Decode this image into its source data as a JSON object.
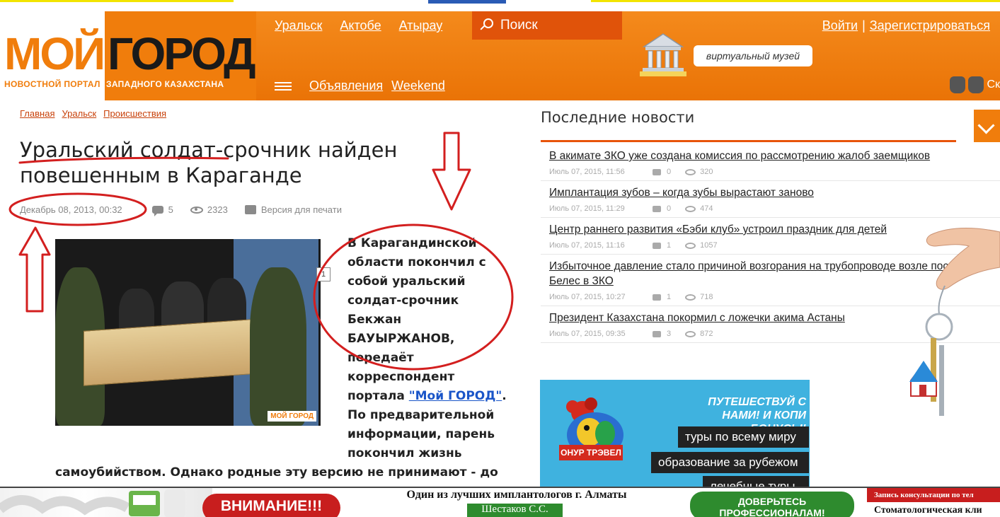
{
  "header": {
    "logo_part1": "МОЙ",
    "logo_part2": "ГОРОД",
    "tagline_part1": "НОВОСТНОЙ ПОРТАЛ",
    "tagline_part2": "ЗАПАДНОГО КАЗАХСТАНА",
    "cities": [
      "Уральск",
      "Актобе",
      "Атырау"
    ],
    "search_placeholder": "Поиск",
    "login": "Войти",
    "separator": "|",
    "register": "Зарегистрироваться",
    "museum_label": "виртуальный музей",
    "sub_links": [
      "Объявления",
      "Weekend"
    ],
    "apps_label": "Ск"
  },
  "breadcrumb": [
    "Главная",
    "Уральск",
    "Происшествия"
  ],
  "article": {
    "title": "Уральский солдат-срочник найден повешенным в Караганде",
    "date": "Декабрь 08, 2013, 00:32",
    "comments": "5",
    "views": "2323",
    "print": "Версия для печати",
    "footnote_badge": "1",
    "photo_watermark": "МОЙ ГОРОД",
    "text_lead": "В Карагандинской области покончил с собой уральский солдат-срочник Бекжан БАУЫРЖАНОВ, передаёт корреспондент портала ",
    "text_link": "\"Мой ГОРОД\"",
    "text_after_link": ". По предварительной информации, парень покончил жизнь",
    "text_continuation": "самоубийством. Однако родные эту версию не принимают - до"
  },
  "sidebar": {
    "title": "Последние новости",
    "news": [
      {
        "title": "В акимате ЗКО уже создана комиссия по рассмотрению жалоб заемщиков",
        "date": "Июль 07, 2015, 11:56",
        "comments": "0",
        "views": "320"
      },
      {
        "title": "Имплантация зубов – когда зубы вырастают заново",
        "date": "Июль 07, 2015, 11:29",
        "comments": "0",
        "views": "474"
      },
      {
        "title": "Центр раннего развития «Бэби клуб» устроил праздник для детей",
        "date": "Июль 07, 2015, 11:16",
        "comments": "1",
        "views": "1057"
      },
      {
        "title": "Избыточное давление стало причиной возгорания на трубопроводе возле поселка Белес в ЗКО",
        "date": "Июль 07, 2015, 10:27",
        "comments": "1",
        "views": "718"
      },
      {
        "title": "Президент Казахстана покормил с ложечки акима Астаны",
        "date": "Июль 07, 2015, 09:35",
        "comments": "3",
        "views": "872"
      }
    ]
  },
  "travel_ad": {
    "headline": "ПУТЕШЕСТВУЙ С НАМИ! И КОПИ БОНУСЫ!",
    "pills": [
      "туры по всему миру",
      "образование за рубежом",
      "лечебные туры"
    ],
    "brand": "ОНУР ТРЭВЕЛ"
  },
  "bottom_banner": {
    "red_label": "ВНИМАНИЕ!!!",
    "headline": "Один из лучших имплантологов г. Алматы",
    "doctor": "Шестаков С.С.",
    "green_label": "ДОВЕРЬТЕСЬ ПРОФЕССИОНАЛАМ!",
    "right_top": "Запись консультации по тел",
    "right_bottom": "Стоматологическая кли"
  },
  "colors": {
    "brand_orange": "#f07d0c",
    "search_bg": "#e0530a",
    "annotation_red": "#d31f1f",
    "link_blue": "#1a55c8"
  }
}
